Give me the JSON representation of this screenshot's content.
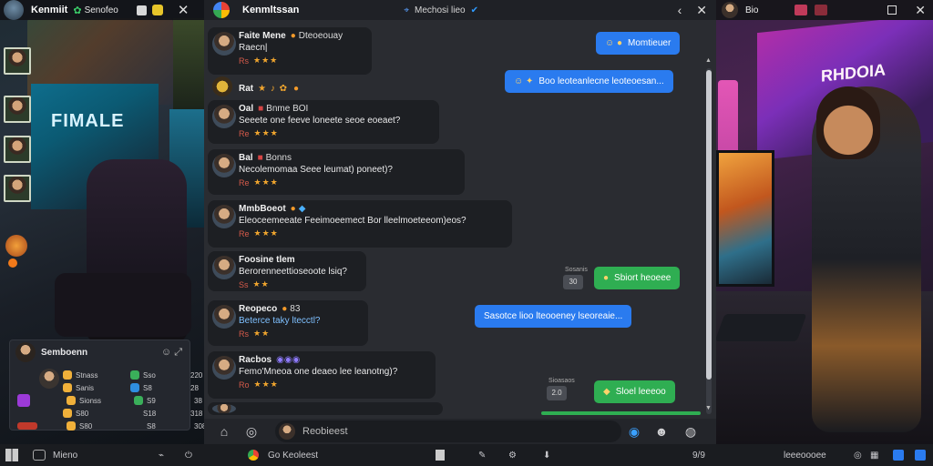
{
  "left_panel": {
    "title": "Kenmiit",
    "subtitle": "Senofeo",
    "art_text": "FIMALE",
    "mini_card": {
      "name": "Semboenn",
      "rows": [
        {
          "c1": "Stnass",
          "c2": "Sso",
          "c3": "220"
        },
        {
          "c1": "Sanis",
          "c2": "S8",
          "c3": "28"
        },
        {
          "c1": "Sionss",
          "c2": "S9",
          "c3": "38"
        },
        {
          "c1": "S80",
          "c2": "S18",
          "c3": "318"
        },
        {
          "c1": "S80",
          "c2": "S8",
          "c3": "308"
        }
      ]
    }
  },
  "chat": {
    "app_title": "Kenmltssan",
    "channel": "Mechosi lieo",
    "placeholder": "Reobieest",
    "messages_in": [
      {
        "name": "Faite Mene",
        "extra": "Dteoeouay",
        "body": "Raecn|",
        "time": "Rs"
      },
      {
        "name": "Rat",
        "extra": "",
        "body": "",
        "time": ""
      },
      {
        "name": "Oal",
        "extra": "Bnme BOI",
        "body": "Seeete one feeve loneete seoe eoeaet?",
        "time": "Re"
      },
      {
        "name": "Bal",
        "extra": "Bonns",
        "body": "Necolemomaa Seee leumat) poneet)?",
        "time": "Re"
      },
      {
        "name": "MmbBoeot",
        "extra": "",
        "body": "Eleoceemeeate Feeimoeemect Bor lleelmoeteeom)eos?",
        "time": "Re"
      },
      {
        "name": "Foosine tlem",
        "extra": "",
        "body": "Berorenneettioseoote lsiq?",
        "time": "Ss"
      },
      {
        "name": "Reopeco",
        "extra": "83",
        "body": "Beterce taky ltecctl?",
        "time": "Rs"
      },
      {
        "name": "Racbos",
        "extra": "",
        "body": "Femo'Mneoa one deaeo lee leanotng)?",
        "time": "Ro"
      },
      {
        "name": "",
        "extra": "",
        "body": "",
        "time": ""
      }
    ],
    "messages_out": [
      {
        "text": "Momtieuer",
        "icon": "R"
      },
      {
        "text": "Boo leoteanlecne leoteoesan...",
        "icon": "☺"
      },
      {
        "text": "Sbiort heoeee",
        "ts": "Sosanis",
        "badge": "30"
      },
      {
        "text": "Sasotce  lioo  lteooeney lseoreaie...",
        "icon": "☺"
      },
      {
        "text": "Sloel leeeoo",
        "ts": "Sioasaos",
        "badge": "2.0"
      }
    ]
  },
  "right_panel": {
    "name": "Bio",
    "poster_text": "RHDOIA"
  },
  "taskbar": {
    "item1": "Mieno",
    "item2": "Go Keoleest",
    "time": "9/9",
    "item3": "leeeoooee"
  }
}
